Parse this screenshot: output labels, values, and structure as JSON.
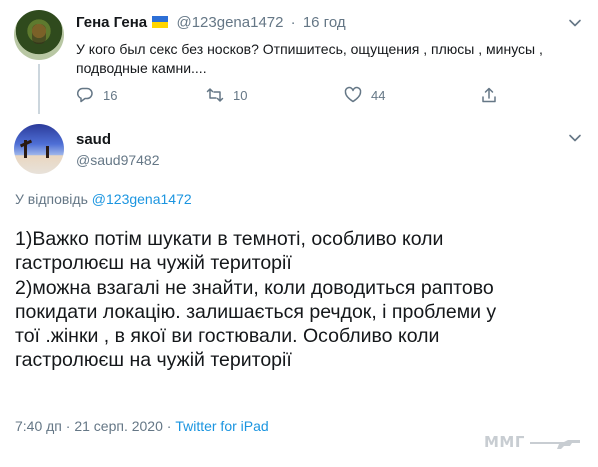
{
  "tweet1": {
    "name": "Гена Гена",
    "handle": "@123gena1472",
    "separator": "·",
    "time": "16 год",
    "text": "У кого был секс без носков? Отпишитесь, ощущения , плюсы , минусы , подводные камни....",
    "replies": "16",
    "retweets": "10",
    "likes": "44"
  },
  "tweet2": {
    "name": "saud",
    "handle": "@saud97482",
    "reply_prefix": "У відповідь",
    "reply_handle": "@123gena1472",
    "lines": [
      "1)Важко потім шукати в темноті, особливо коли",
      "гастролюєш на чужій території",
      "2)можна взагалі не знайти, коли доводиться раптово",
      "покидати локацію.  залишається речдок, і проблеми у",
      "тої .жінки , в якої ви гостювали. Особливо коли",
      "гастролюєш на чужій території"
    ],
    "timestamp": "7:40 дп · 21 серп. 2020 · ",
    "source": "Twitter for iPad"
  },
  "watermark": {
    "text": "ММГ"
  },
  "colors": {
    "secondary": "#657786",
    "link": "#1b95e0",
    "text": "#14171a",
    "flag_blue": "#2d6fd6",
    "flag_yellow": "#ffd500"
  }
}
